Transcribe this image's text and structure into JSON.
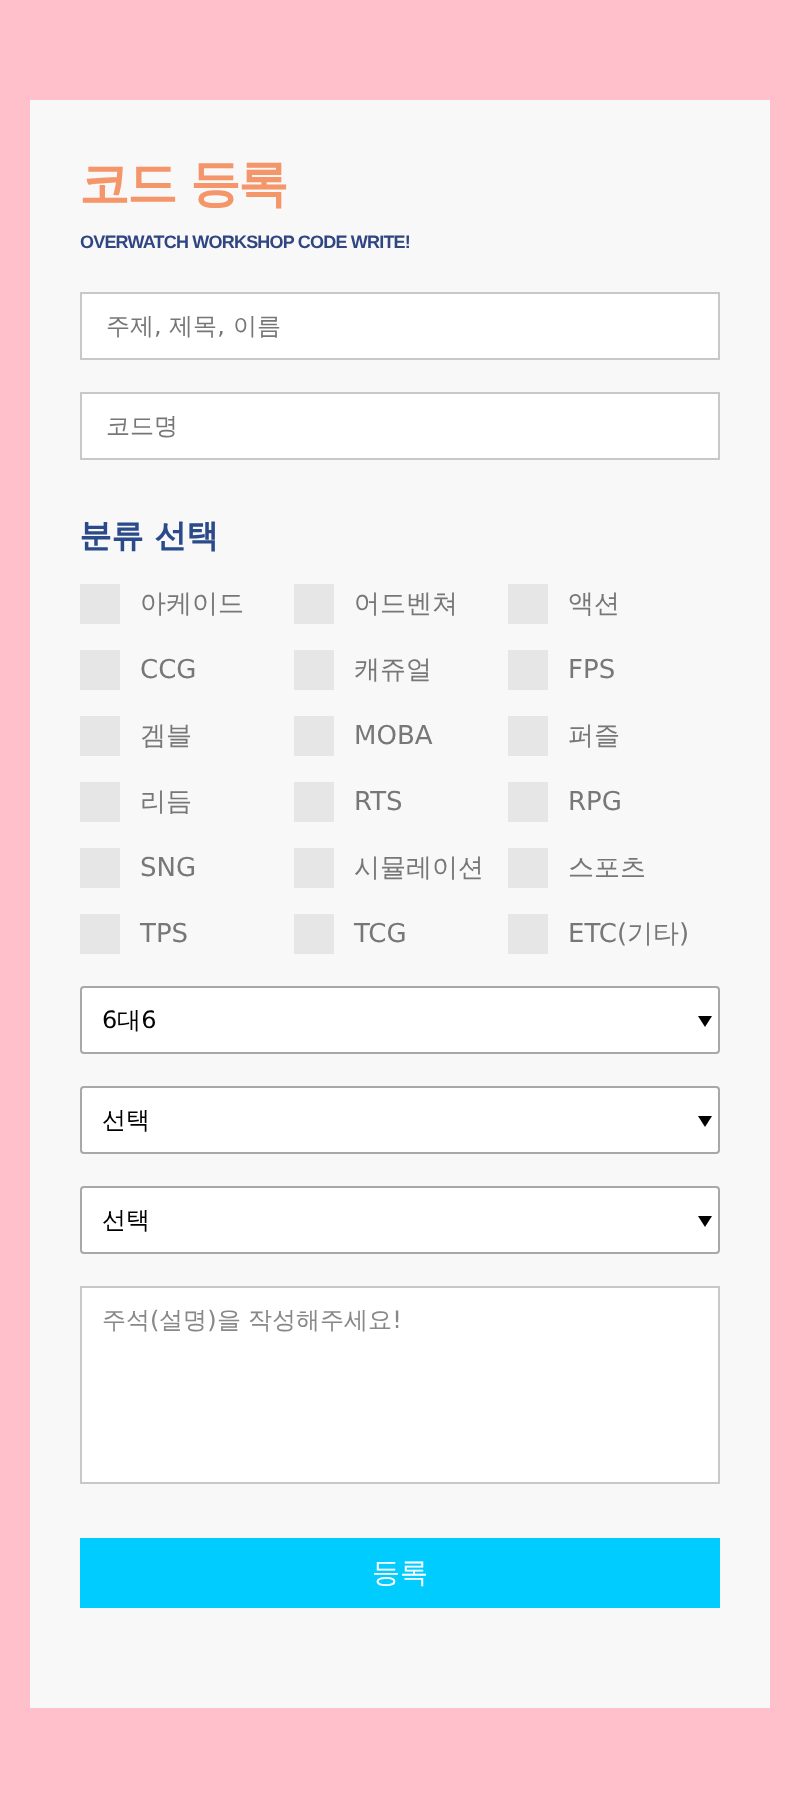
{
  "title": "코드 등록",
  "subtitle": "OVERWATCH WORKSHOP CODE WRITE!",
  "fields": [
    {
      "placeholder": "주제, 제목, 이름"
    },
    {
      "placeholder": "코드명"
    }
  ],
  "category_heading": "분류 선택",
  "categories": [
    {
      "label": "아케이드",
      "checked": false
    },
    {
      "label": "어드벤쳐",
      "checked": false
    },
    {
      "label": "액션",
      "checked": false
    },
    {
      "label": "CCG",
      "checked": false
    },
    {
      "label": "캐쥬얼",
      "checked": false
    },
    {
      "label": "FPS",
      "checked": false
    },
    {
      "label": "겜블",
      "checked": false
    },
    {
      "label": "MOBA",
      "checked": false
    },
    {
      "label": "퍼즐",
      "checked": false
    },
    {
      "label": "리듬",
      "checked": false
    },
    {
      "label": "RTS",
      "checked": false
    },
    {
      "label": "RPG",
      "checked": false
    },
    {
      "label": "SNG",
      "checked": false
    },
    {
      "label": "시뮬레이션",
      "checked": false
    },
    {
      "label": "스포츠",
      "checked": false
    },
    {
      "label": "TPS",
      "checked": false
    },
    {
      "label": "TCG",
      "checked": false
    },
    {
      "label": "ETC(기타)",
      "checked": false
    }
  ],
  "dropdowns": [
    {
      "value": "6대6"
    },
    {
      "value": "선택"
    },
    {
      "value": "선택"
    }
  ],
  "notes": {
    "placeholder": "주석(설명)을 작성해주세요!"
  },
  "submit": "등록"
}
